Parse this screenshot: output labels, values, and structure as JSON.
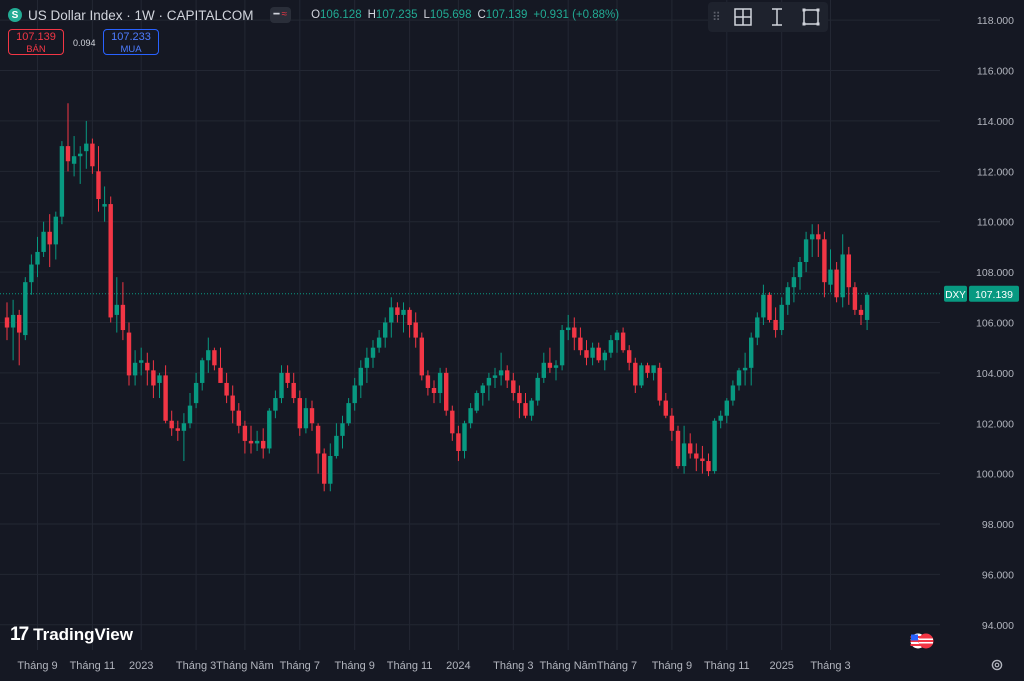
{
  "header": {
    "symbol_icon": "S",
    "title": "US Dollar Index · 1W · CAPITALCOM",
    "toggle_icons": [
      "minus-icon",
      "wave-icon"
    ],
    "ohlc": {
      "o_label": "O",
      "o": "106.128",
      "h_label": "H",
      "h": "107.235",
      "l_label": "L",
      "l": "105.698",
      "c_label": "C",
      "c": "107.139",
      "change": "+0.931 (+0.88%)"
    }
  },
  "trade": {
    "sell_price": "107.139",
    "sell_label": "BÁN",
    "spread": "0.094",
    "buy_price": "107.233",
    "buy_label": "MUA"
  },
  "drawing_toolbar": [
    "crosshair-box-icon",
    "text-cursor-icon",
    "rectangle-icon"
  ],
  "branding": {
    "logo_mark": "17",
    "logo_text": "TradingView"
  },
  "colors": {
    "background": "#151823",
    "grid": "#232733",
    "up": "#089981",
    "down": "#f23645",
    "price_line": "#089981",
    "axis_text": "#b2b5be"
  },
  "chart_data": {
    "type": "candlestick",
    "interval": "1W",
    "symbol": "DXY",
    "last_price_label": "107.139",
    "ylim": [
      93.0,
      118.8
    ],
    "y_ticks": [
      "118.000",
      "116.000",
      "114.000",
      "112.000",
      "110.000",
      "108.000",
      "106.000",
      "104.000",
      "102.000",
      "100.000",
      "98.000",
      "96.000",
      "94.000"
    ],
    "x_tick_labels": [
      {
        "label": "Tháng 9",
        "index": 5
      },
      {
        "label": "Tháng 11",
        "index": 14
      },
      {
        "label": "2023",
        "index": 22
      },
      {
        "label": "Tháng 3",
        "index": 31
      },
      {
        "label": "Tháng Năm",
        "index": 39
      },
      {
        "label": "Tháng 7",
        "index": 48
      },
      {
        "label": "Tháng 9",
        "index": 57
      },
      {
        "label": "Tháng 11",
        "index": 66
      },
      {
        "label": "2024",
        "index": 74
      },
      {
        "label": "Tháng 3",
        "index": 83
      },
      {
        "label": "Tháng Năm",
        "index": 92
      },
      {
        "label": "Tháng 7",
        "index": 100
      },
      {
        "label": "Tháng 9",
        "index": 109
      },
      {
        "label": "Tháng 11",
        "index": 118
      },
      {
        "label": "2025",
        "index": 127
      },
      {
        "label": "Tháng 3",
        "index": 135
      }
    ],
    "candles": [
      [
        106.2,
        106.8,
        105.3,
        105.8
      ],
      [
        105.8,
        106.9,
        104.5,
        106.3
      ],
      [
        106.3,
        106.5,
        104.3,
        105.6
      ],
      [
        105.5,
        107.8,
        105.3,
        107.6
      ],
      [
        107.6,
        108.7,
        107.1,
        108.3
      ],
      [
        108.3,
        109.4,
        107.8,
        108.8
      ],
      [
        108.8,
        110.0,
        108.6,
        109.6
      ],
      [
        109.6,
        110.3,
        108.2,
        109.1
      ],
      [
        109.1,
        110.4,
        108.5,
        110.2
      ],
      [
        110.2,
        113.2,
        109.9,
        113.0
      ],
      [
        113.0,
        114.7,
        112.0,
        112.4
      ],
      [
        112.3,
        113.4,
        111.8,
        112.6
      ],
      [
        112.6,
        113.0,
        111.5,
        112.7
      ],
      [
        112.8,
        114.0,
        112.1,
        113.1
      ],
      [
        113.1,
        113.3,
        111.9,
        112.2
      ],
      [
        112.0,
        113.0,
        110.4,
        110.9
      ],
      [
        110.6,
        111.4,
        110.0,
        110.7
      ],
      [
        110.7,
        111.0,
        106.0,
        106.2
      ],
      [
        106.3,
        107.8,
        105.6,
        106.7
      ],
      [
        106.7,
        107.6,
        105.3,
        105.7
      ],
      [
        105.6,
        106.0,
        103.5,
        103.9
      ],
      [
        103.9,
        104.9,
        103.5,
        104.4
      ],
      [
        104.4,
        105.0,
        103.9,
        104.5
      ],
      [
        104.4,
        104.8,
        103.5,
        104.1
      ],
      [
        104.1,
        104.5,
        103.0,
        103.5
      ],
      [
        103.6,
        104.0,
        103.0,
        103.9
      ],
      [
        103.9,
        104.3,
        102.0,
        102.1
      ],
      [
        102.1,
        102.5,
        101.5,
        101.8
      ],
      [
        101.8,
        102.1,
        101.3,
        101.7
      ],
      [
        101.7,
        102.4,
        100.5,
        102.0
      ],
      [
        102.0,
        103.2,
        101.8,
        102.7
      ],
      [
        102.8,
        104.0,
        102.6,
        103.6
      ],
      [
        103.6,
        104.6,
        103.3,
        104.5
      ],
      [
        104.5,
        105.4,
        104.0,
        104.9
      ],
      [
        104.9,
        105.0,
        104.1,
        104.3
      ],
      [
        104.2,
        105.0,
        103.6,
        103.6
      ],
      [
        103.6,
        104.0,
        102.8,
        103.1
      ],
      [
        103.1,
        103.5,
        102.0,
        102.5
      ],
      [
        102.5,
        102.8,
        101.6,
        101.9
      ],
      [
        101.9,
        102.1,
        100.8,
        101.3
      ],
      [
        101.3,
        101.9,
        100.8,
        101.2
      ],
      [
        101.2,
        101.7,
        100.9,
        101.3
      ],
      [
        101.3,
        101.8,
        100.6,
        101.0
      ],
      [
        101.0,
        102.6,
        100.8,
        102.5
      ],
      [
        102.5,
        103.3,
        102.2,
        103.0
      ],
      [
        103.0,
        104.3,
        102.8,
        104.0
      ],
      [
        104.0,
        104.3,
        103.4,
        103.6
      ],
      [
        103.6,
        104.0,
        102.8,
        103.0
      ],
      [
        103.0,
        103.3,
        101.5,
        101.8
      ],
      [
        101.8,
        103.0,
        101.6,
        102.6
      ],
      [
        102.6,
        102.9,
        101.7,
        102.0
      ],
      [
        101.9,
        102.0,
        100.0,
        100.8
      ],
      [
        100.8,
        101.0,
        99.3,
        99.6
      ],
      [
        99.6,
        101.2,
        99.3,
        100.7
      ],
      [
        100.7,
        102.0,
        100.6,
        101.5
      ],
      [
        101.5,
        102.3,
        101.0,
        102.0
      ],
      [
        102.0,
        103.0,
        101.9,
        102.8
      ],
      [
        102.8,
        103.8,
        102.5,
        103.5
      ],
      [
        103.5,
        104.5,
        103.0,
        104.2
      ],
      [
        104.2,
        105.0,
        103.6,
        104.6
      ],
      [
        104.6,
        105.3,
        104.2,
        105.0
      ],
      [
        105.0,
        105.7,
        104.8,
        105.4
      ],
      [
        105.4,
        106.2,
        105.0,
        106.0
      ],
      [
        106.0,
        107.0,
        105.4,
        106.6
      ],
      [
        106.6,
        106.8,
        106.0,
        106.3
      ],
      [
        106.3,
        106.8,
        105.6,
        106.5
      ],
      [
        106.5,
        106.6,
        105.4,
        105.9
      ],
      [
        106.0,
        106.4,
        105.0,
        105.4
      ],
      [
        105.4,
        105.6,
        103.7,
        103.9
      ],
      [
        103.9,
        104.1,
        103.1,
        103.4
      ],
      [
        103.4,
        103.7,
        102.8,
        103.2
      ],
      [
        103.2,
        104.2,
        102.8,
        104.0
      ],
      [
        104.0,
        104.2,
        102.3,
        102.5
      ],
      [
        102.5,
        102.7,
        101.3,
        101.6
      ],
      [
        101.6,
        101.9,
        100.5,
        100.9
      ],
      [
        100.9,
        102.1,
        100.6,
        102.0
      ],
      [
        102.0,
        102.8,
        101.8,
        102.6
      ],
      [
        102.5,
        103.3,
        102.4,
        103.2
      ],
      [
        103.2,
        103.6,
        102.7,
        103.5
      ],
      [
        103.5,
        104.0,
        102.9,
        103.8
      ],
      [
        103.8,
        104.2,
        103.4,
        103.9
      ],
      [
        103.9,
        104.8,
        103.5,
        104.1
      ],
      [
        104.1,
        104.3,
        103.4,
        103.7
      ],
      [
        103.7,
        104.0,
        102.9,
        103.2
      ],
      [
        103.2,
        103.5,
        102.2,
        102.8
      ],
      [
        102.8,
        103.2,
        102.2,
        102.3
      ],
      [
        102.3,
        103.0,
        102.1,
        102.9
      ],
      [
        102.9,
        104.0,
        102.7,
        103.8
      ],
      [
        103.8,
        104.8,
        103.6,
        104.4
      ],
      [
        104.4,
        105.0,
        104.0,
        104.2
      ],
      [
        104.2,
        104.5,
        103.7,
        104.3
      ],
      [
        104.3,
        105.9,
        104.1,
        105.7
      ],
      [
        105.7,
        106.3,
        105.3,
        105.8
      ],
      [
        105.8,
        106.2,
        104.9,
        105.4
      ],
      [
        105.4,
        105.8,
        104.7,
        104.9
      ],
      [
        104.9,
        105.3,
        104.3,
        104.6
      ],
      [
        104.6,
        105.2,
        104.3,
        105.0
      ],
      [
        105.0,
        105.2,
        104.4,
        104.5
      ],
      [
        104.5,
        104.9,
        104.1,
        104.8
      ],
      [
        104.8,
        105.5,
        104.6,
        105.3
      ],
      [
        105.3,
        105.7,
        104.8,
        105.6
      ],
      [
        105.6,
        105.8,
        104.8,
        104.9
      ],
      [
        104.9,
        105.1,
        104.1,
        104.4
      ],
      [
        104.4,
        104.6,
        103.2,
        103.5
      ],
      [
        103.5,
        104.4,
        103.4,
        104.3
      ],
      [
        104.3,
        104.4,
        103.8,
        104.0
      ],
      [
        104.0,
        104.2,
        103.7,
        104.3
      ],
      [
        104.2,
        104.4,
        102.7,
        102.9
      ],
      [
        102.9,
        103.2,
        102.2,
        102.3
      ],
      [
        102.3,
        102.6,
        101.3,
        101.7
      ],
      [
        101.7,
        101.9,
        100.2,
        100.3
      ],
      [
        100.3,
        101.9,
        100.0,
        101.2
      ],
      [
        101.2,
        101.6,
        100.6,
        100.8
      ],
      [
        100.8,
        101.2,
        100.1,
        100.6
      ],
      [
        100.6,
        101.1,
        100.0,
        100.5
      ],
      [
        100.5,
        100.8,
        99.9,
        100.1
      ],
      [
        100.1,
        102.2,
        100.0,
        102.1
      ],
      [
        102.1,
        102.5,
        101.8,
        102.3
      ],
      [
        102.3,
        103.0,
        102.0,
        102.9
      ],
      [
        102.9,
        103.7,
        102.7,
        103.5
      ],
      [
        103.5,
        104.2,
        103.3,
        104.1
      ],
      [
        104.1,
        104.8,
        103.5,
        104.2
      ],
      [
        104.2,
        105.6,
        103.5,
        105.4
      ],
      [
        105.4,
        106.4,
        105.1,
        106.2
      ],
      [
        106.2,
        107.5,
        105.9,
        107.1
      ],
      [
        107.1,
        107.2,
        106.0,
        106.1
      ],
      [
        106.1,
        106.6,
        105.4,
        105.7
      ],
      [
        105.7,
        107.0,
        105.5,
        106.7
      ],
      [
        106.7,
        107.6,
        106.3,
        107.4
      ],
      [
        107.4,
        108.2,
        106.8,
        107.8
      ],
      [
        107.8,
        108.6,
        107.3,
        108.4
      ],
      [
        108.4,
        109.6,
        108.0,
        109.3
      ],
      [
        109.3,
        109.9,
        108.6,
        109.5
      ],
      [
        109.5,
        109.9,
        108.6,
        109.3
      ],
      [
        109.3,
        109.6,
        107.0,
        107.6
      ],
      [
        107.5,
        108.9,
        107.2,
        108.1
      ],
      [
        108.1,
        108.4,
        106.8,
        107.0
      ],
      [
        107.0,
        109.5,
        106.6,
        108.7
      ],
      [
        108.7,
        109.0,
        106.7,
        107.4
      ],
      [
        107.4,
        107.6,
        106.3,
        106.5
      ],
      [
        106.5,
        106.7,
        105.9,
        106.3
      ],
      [
        106.1,
        107.2,
        105.7,
        107.1
      ]
    ]
  }
}
